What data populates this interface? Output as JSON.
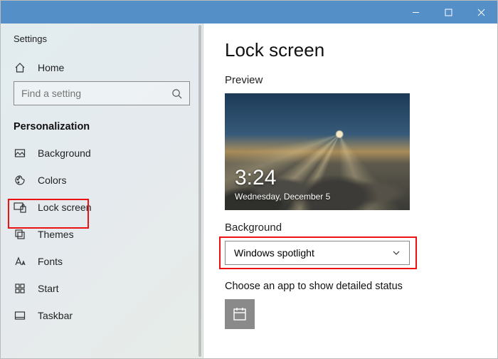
{
  "window": {
    "title": "Settings"
  },
  "sidebar": {
    "home_label": "Home",
    "search_placeholder": "Find a setting",
    "section": "Personalization",
    "items": [
      {
        "label": "Background"
      },
      {
        "label": "Colors"
      },
      {
        "label": "Lock screen"
      },
      {
        "label": "Themes"
      },
      {
        "label": "Fonts"
      },
      {
        "label": "Start"
      },
      {
        "label": "Taskbar"
      }
    ]
  },
  "main": {
    "title": "Lock screen",
    "preview_label": "Preview",
    "lock_time": "3:24",
    "lock_date": "Wednesday, December 5",
    "background_label": "Background",
    "background_value": "Windows spotlight",
    "status_label": "Choose an app to show detailed status"
  }
}
